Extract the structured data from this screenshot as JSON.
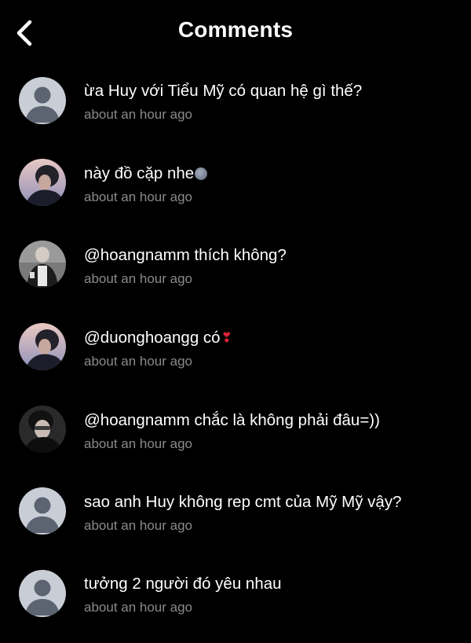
{
  "header": {
    "title": "Comments",
    "back_icon": "chevron-left-icon"
  },
  "colors": {
    "background": "#000000",
    "text": "#ffffff",
    "timestamp": "#8a8a8a",
    "default_avatar_bg": "#c9ced6",
    "default_avatar_fg": "#5c6472"
  },
  "comments": [
    {
      "text": "ừa Huy với Tiểu Mỹ có quan hệ gì thế?",
      "time": "about an hour ago",
      "avatar": "default-avatar",
      "emoji": ""
    },
    {
      "text": "này đồ cặp nhe",
      "time": "about an hour ago",
      "avatar": "photo-avatar",
      "emoji": "blob"
    },
    {
      "text": "@hoangnamm thích không?",
      "time": "about an hour ago",
      "avatar": "photo-avatar",
      "emoji": ""
    },
    {
      "text": "@duonghoangg có",
      "time": "about an hour ago",
      "avatar": "photo-avatar",
      "emoji": "heart"
    },
    {
      "text": "@hoangnamm chắc là không phải đâu=))",
      "time": "about an hour ago",
      "avatar": "photo-avatar",
      "emoji": ""
    },
    {
      "text": "sao anh Huy không rep cmt của Mỹ Mỹ vậy?",
      "time": "about an hour ago",
      "avatar": "default-avatar",
      "emoji": ""
    },
    {
      "text": "tưởng 2 người đó yêu nhau",
      "time": "about an hour ago",
      "avatar": "default-avatar",
      "emoji": ""
    }
  ]
}
